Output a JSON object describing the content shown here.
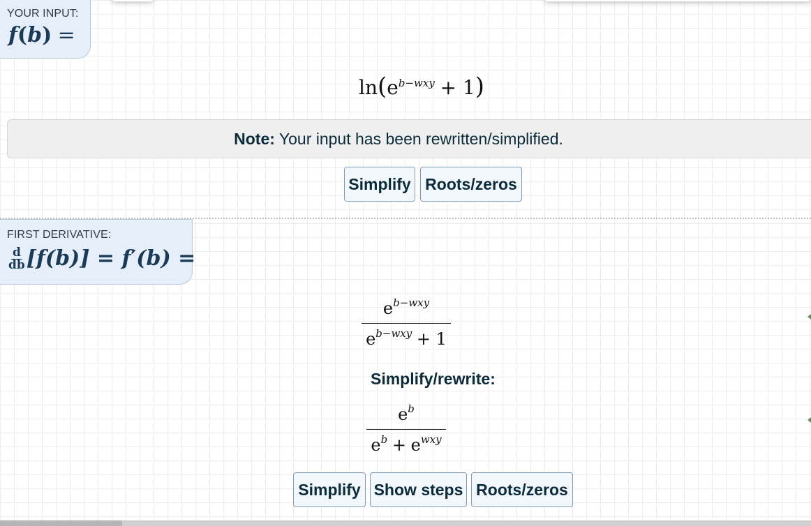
{
  "input_section": {
    "caption": "YOUR INPUT:",
    "label_f": "f",
    "label_var": "b",
    "label_eq": "=",
    "expression": {
      "fn": "ln",
      "base": "e",
      "exponent": "b−wxy",
      "plus": "+ 1"
    },
    "note_bold": "Note:",
    "note_text": " Your input has been rewritten/simplified.",
    "buttons": [
      "Simplify",
      "Roots/zeros"
    ]
  },
  "derivative_section": {
    "caption": "FIRST DERIVATIVE:",
    "d_num": "d",
    "d_den": "db",
    "label_rest_1": "[f(b)] = f",
    "label_prime": "′",
    "label_rest_2": "(b) =",
    "result": {
      "num_base": "e",
      "num_exp": "b−wxy",
      "den_base": "e",
      "den_exp": "b−wxy",
      "den_plus": "+ 1"
    },
    "simplify_label": "Simplify/rewrite:",
    "simplified": {
      "num_base": "e",
      "num_exp": "b",
      "den_base1": "e",
      "den_exp1": "b",
      "den_plus": "+",
      "den_base2": "e",
      "den_exp2": "wxy"
    },
    "buttons": [
      "Simplify",
      "Show steps",
      "Roots/zeros"
    ]
  }
}
